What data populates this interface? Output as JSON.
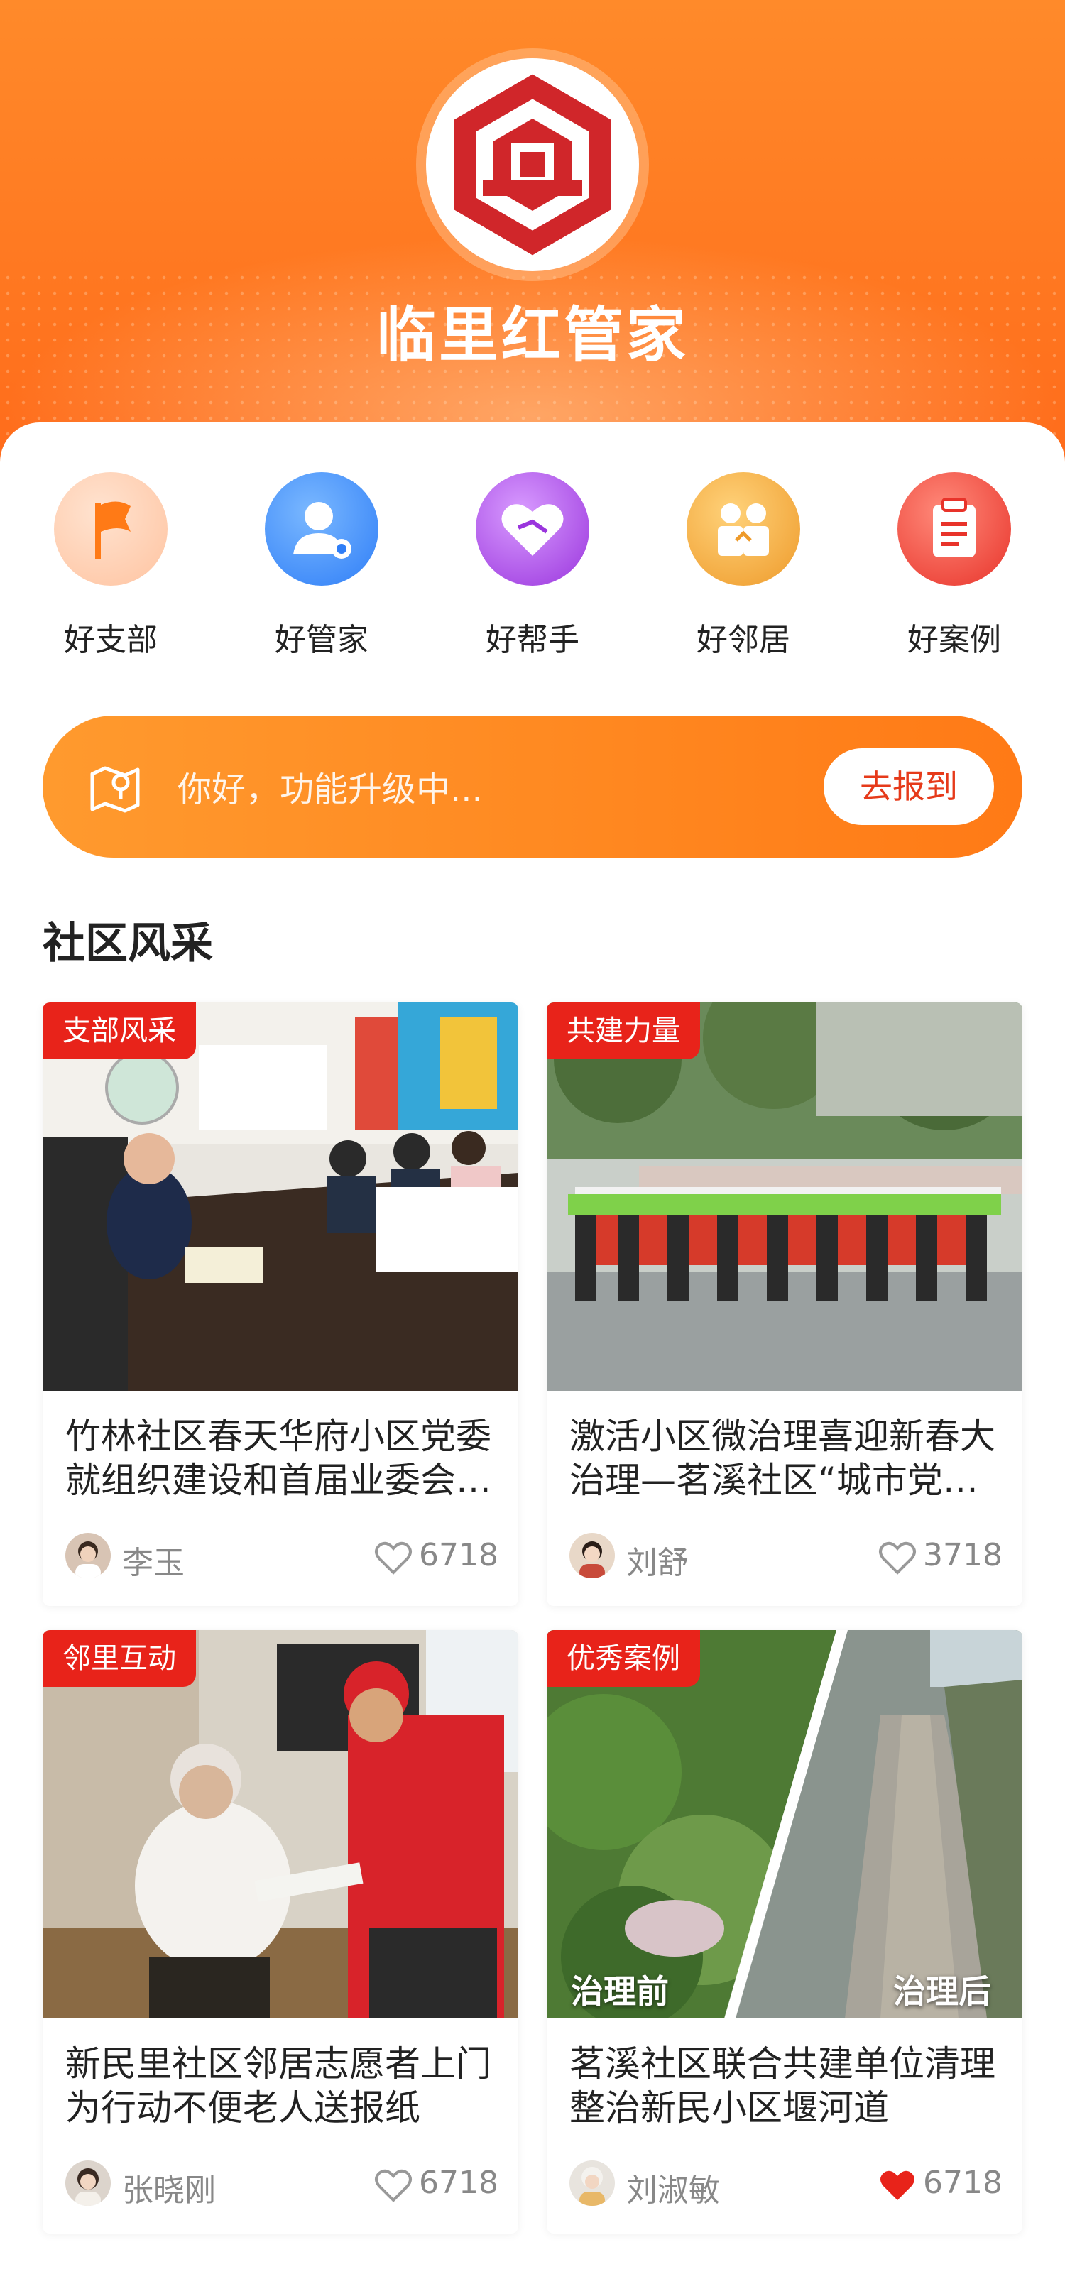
{
  "app": {
    "title": "临里红管家"
  },
  "nav": [
    {
      "label": "好支部",
      "icon": "flag-icon",
      "color": "#ff8a4a"
    },
    {
      "label": "好管家",
      "icon": "user-star-icon",
      "color": "#3a8cff"
    },
    {
      "label": "好帮手",
      "icon": "heart-handshake-icon",
      "color": "#b04adf"
    },
    {
      "label": "好邻居",
      "icon": "neighbors-icon",
      "color": "#f0a53a"
    },
    {
      "label": "好案例",
      "icon": "clipboard-icon",
      "color": "#ee4a3a"
    }
  ],
  "banner": {
    "text": "你好，功能升级中...",
    "button": "去报到",
    "icon": "location-map-icon"
  },
  "section": {
    "title": "社区风采"
  },
  "posts": [
    {
      "tag": "支部风采",
      "title": "竹林社区春天华府小区党委就组织建设和首届业委会换届等事宜召开会议",
      "author": "李玉",
      "likes": "6718",
      "liked": false
    },
    {
      "tag": "共建力量",
      "title": "激活小区微治理喜迎新春大治理—茗溪社区“城市党建日”活动",
      "author": "刘舒",
      "likes": "3718",
      "liked": false
    },
    {
      "tag": "邻里互动",
      "title": "新民里社区邻居志愿者上门为行动不便老人送报纸",
      "author": "张晓刚",
      "likes": "6718",
      "liked": false
    },
    {
      "tag": "优秀案例",
      "title": "茗溪社区联合共建单位清理整治新民小区堰河道",
      "author": "刘淑敏",
      "likes": "6718",
      "liked": true,
      "img_labels": {
        "before": "治理前",
        "after": "治理后"
      }
    }
  ],
  "colors": {
    "accent": "#ff7a16",
    "tag": "#e8231a",
    "liked": "#e8231a"
  }
}
